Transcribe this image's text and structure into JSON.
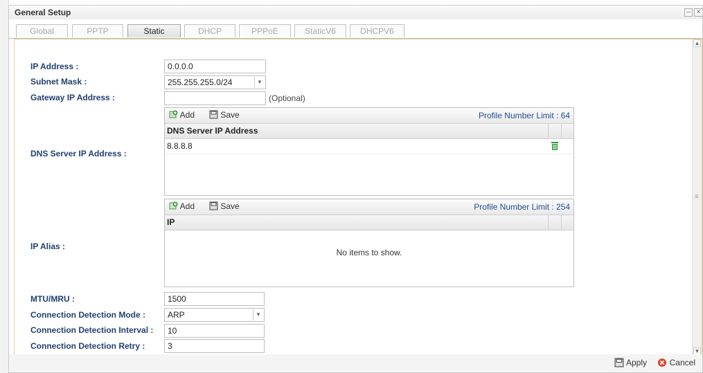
{
  "window": {
    "title": "General Setup",
    "minimize": "–",
    "close": "×"
  },
  "tabs": [
    {
      "label": "Global",
      "active": false
    },
    {
      "label": "PPTP",
      "active": false
    },
    {
      "label": "Static",
      "active": true
    },
    {
      "label": "DHCP",
      "active": false
    },
    {
      "label": "PPPoE",
      "active": false
    },
    {
      "label": "StaticV6",
      "active": false
    },
    {
      "label": "DHCPV6",
      "active": false
    }
  ],
  "form": {
    "ip_address": {
      "label": "IP Address :",
      "value": "0.0.0.0"
    },
    "subnet_mask": {
      "label": "Subnet Mask :",
      "value": "255.255.255.0/24"
    },
    "gateway": {
      "label": "Gateway IP Address :",
      "value": "",
      "hint": "(Optional)"
    },
    "dns": {
      "label": "DNS Server IP Address :",
      "add": "Add",
      "save": "Save",
      "limit": "Profile Number Limit : 64",
      "column": "DNS Server IP Address",
      "rows": [
        "8.8.8.8"
      ]
    },
    "ip_alias": {
      "label": "IP Alias :",
      "add": "Add",
      "save": "Save",
      "limit": "Profile Number Limit : 254",
      "column": "IP",
      "empty": "No items to show."
    },
    "mtu": {
      "label": "MTU/MRU :",
      "value": "1500"
    },
    "detect_mode": {
      "label": "Connection Detection Mode :",
      "value": "ARP"
    },
    "detect_interval": {
      "label": "Connection Detection Interval :",
      "value": "10"
    },
    "detect_retry": {
      "label": "Connection Detection Retry :",
      "value": "3"
    }
  },
  "footer": {
    "apply": "Apply",
    "cancel": "Cancel"
  },
  "colors": {
    "label": "#213f70",
    "accent_border": "#e8cc8a",
    "trash": "#2e9a3a",
    "add": "#3c9e3c",
    "cancel": "#d84a2c"
  }
}
